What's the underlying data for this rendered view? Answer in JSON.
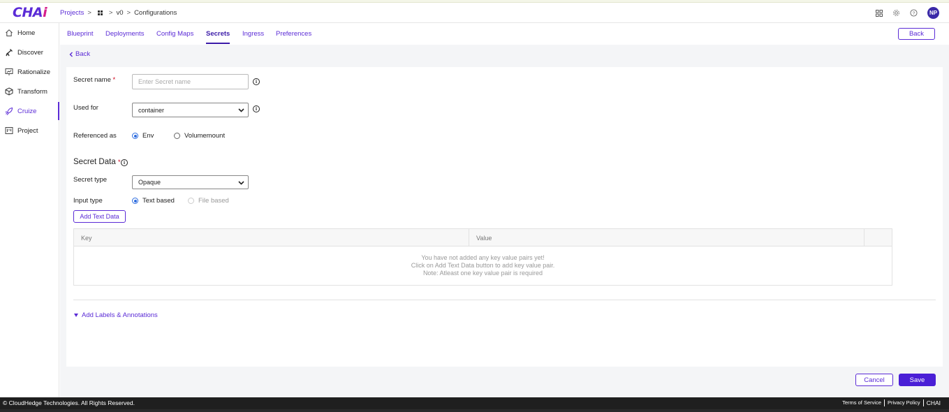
{
  "header": {
    "logo_main": "CHA",
    "logo_accent": "i",
    "breadcrumb": {
      "projects": "Projects",
      "sep": ">",
      "version": "v0",
      "current": "Configurations"
    },
    "avatar_initials": "NP",
    "icons": [
      "apps-grid-icon",
      "gear-icon",
      "help-icon"
    ]
  },
  "sidebar": {
    "items": [
      {
        "label": "Home",
        "icon": "home-icon"
      },
      {
        "label": "Discover",
        "icon": "telescope-icon"
      },
      {
        "label": "Rationalize",
        "icon": "presentation-chart-icon"
      },
      {
        "label": "Transform",
        "icon": "cube-icon"
      },
      {
        "label": "Cruize",
        "icon": "rocket-icon",
        "active": true
      },
      {
        "label": "Project",
        "icon": "kanban-icon"
      }
    ]
  },
  "tabs": {
    "items": [
      "Blueprint",
      "Deployments",
      "Config Maps",
      "Secrets",
      "Ingress",
      "Preferences"
    ],
    "active": "Secrets",
    "back_button": "Back"
  },
  "form": {
    "back_link": "Back",
    "secret_name_label": "Secret name",
    "required_mark": "*",
    "secret_name_placeholder": "Enter  Secret name",
    "used_for_label": "Used for",
    "used_for_value": "container",
    "referenced_as_label": "Referenced as",
    "referenced_options": [
      "Env",
      "Volumemount"
    ],
    "referenced_selected": "Env",
    "secret_data_title": "Secret Data",
    "secret_type_label": "Secret type",
    "secret_type_value": "Opaque",
    "input_type_label": "Input type",
    "input_type_options": [
      "Text based",
      "File based"
    ],
    "input_type_selected": "Text based",
    "add_text_button": "Add Text Data",
    "table": {
      "columns": [
        "Key",
        "Value"
      ],
      "empty_lines": [
        "You have not added any key value pairs yet!",
        "Click on Add Text Data button to add key value pair.",
        "Note: Atleast one key value pair is required"
      ]
    },
    "labels_annotations_link": "Add Labels & Annotations",
    "cancel_button": "Cancel",
    "save_button": "Save"
  },
  "footer": {
    "copyright": "© CloudHedge Technologies. All Rights Reserved.",
    "links": [
      "Terms of Service",
      "Privacy Policy",
      "CHAI"
    ]
  },
  "colors": {
    "accent": "#5b2bd6",
    "logo_accent": "#d61f8c",
    "save_button": "#4a1fd6",
    "required": "#d0021b"
  }
}
